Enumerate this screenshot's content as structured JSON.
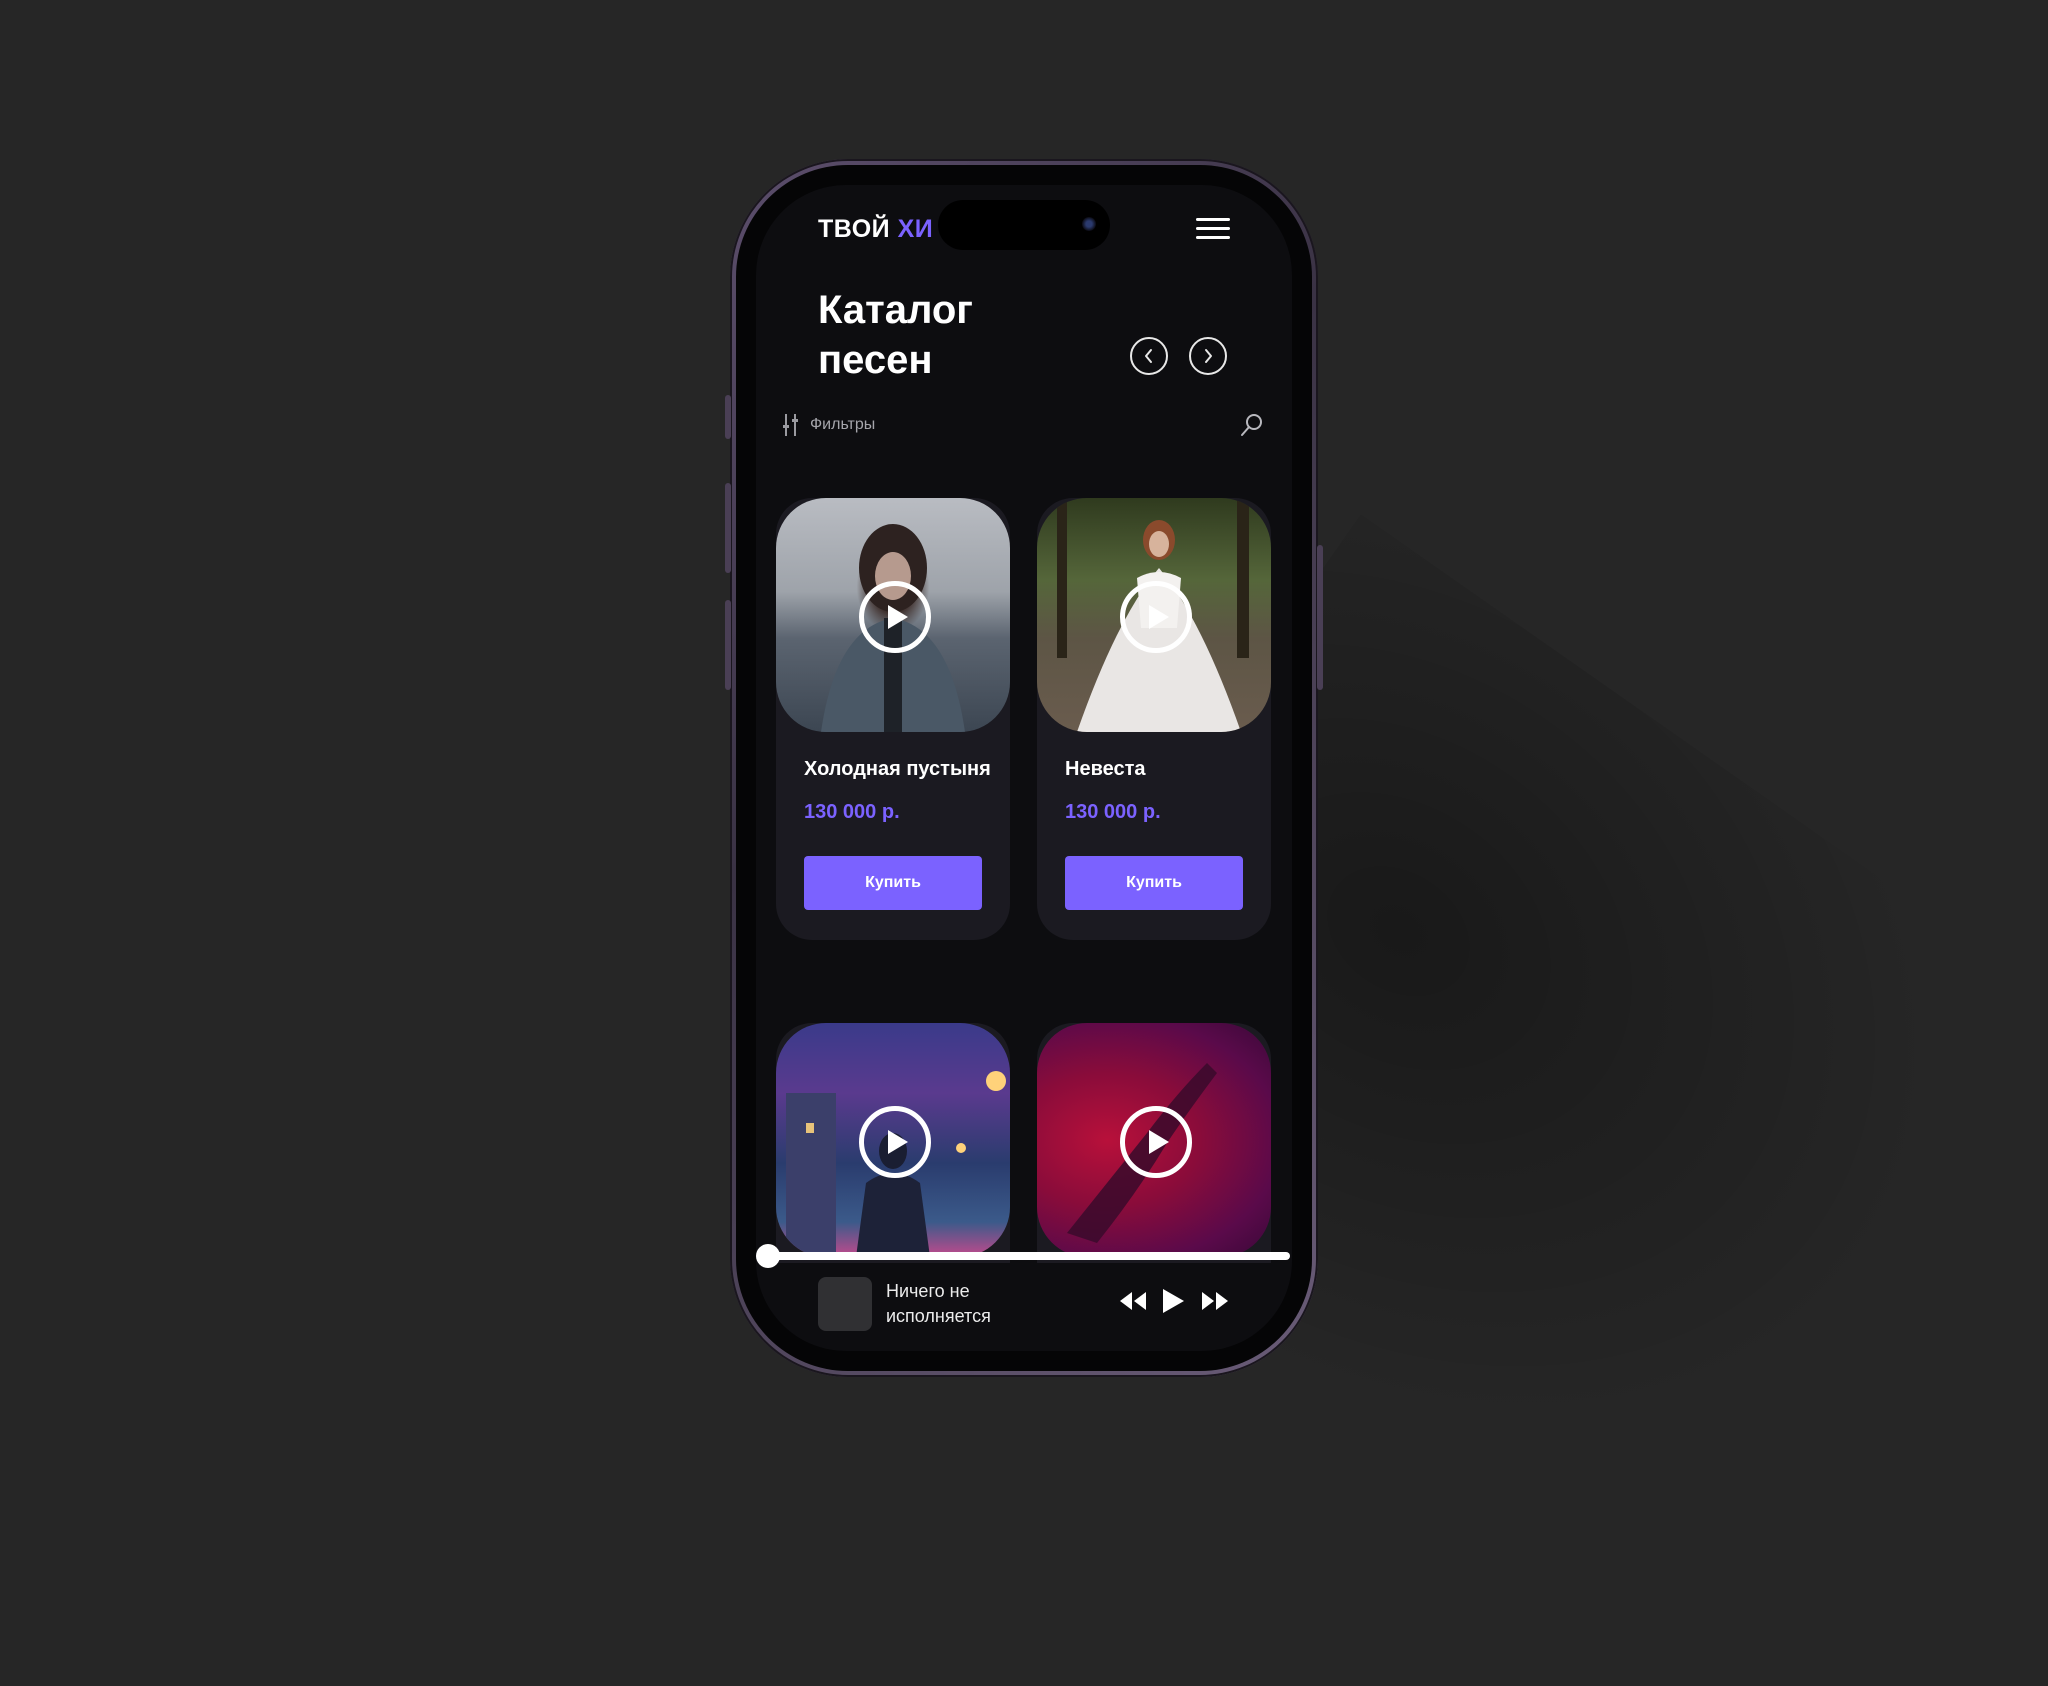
{
  "header": {
    "logo_main": "ТВОЙ ",
    "logo_accent": "ХИ"
  },
  "catalog": {
    "title_line1": "Каталог",
    "title_line2": "песен",
    "filters_label": "Фильтры"
  },
  "cards": [
    {
      "title": "Холодная пустыня",
      "price": "130 000 р.",
      "buy_label": "Купить"
    },
    {
      "title": "Невеста",
      "price": "130 000 р.",
      "buy_label": "Купить"
    },
    {
      "title": "",
      "price": "",
      "buy_label": ""
    },
    {
      "title": "",
      "price": "",
      "buy_label": ""
    }
  ],
  "player": {
    "now_playing": "Ничего не исполняется",
    "progress": 0
  },
  "colors": {
    "accent": "#7b62ff",
    "screen_bg": "#0d0d10",
    "card_bg": "#1b1a21",
    "page_bg": "#262626"
  },
  "icons": [
    "menu-icon",
    "chevron-left-icon",
    "chevron-right-icon",
    "filter-sliders-icon",
    "search-icon",
    "play-icon",
    "rewind-icon",
    "fast-forward-icon"
  ]
}
